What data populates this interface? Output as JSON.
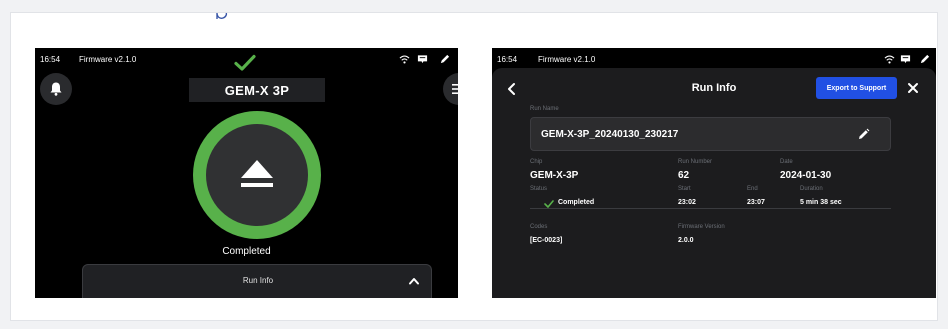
{
  "colors": {
    "success_green": "#58b14a",
    "export_blue": "#2150e4",
    "screen_bg": "#000000",
    "panel_bg": "#1c1c1e"
  },
  "screen_main": {
    "status_bar": {
      "time": "16:54",
      "firmware": "Firmware v2.1.0",
      "icons": [
        "wifi-icon",
        "message-icon",
        "pen-nib-icon"
      ]
    },
    "bell_icon": "bell-icon",
    "menu_icon": "hamburger-menu-icon",
    "status_icon": "checkmark-icon",
    "device_name": "GEM-X 3P",
    "center_icon": "eject-icon",
    "state_label": "Completed",
    "drawer": {
      "label": "Run Info",
      "icon": "chevron-up-icon"
    }
  },
  "screen_runinfo": {
    "status_bar": {
      "time": "16:54",
      "firmware": "Firmware v2.1.0",
      "icons": [
        "wifi-icon",
        "message-icon",
        "pen-nib-icon"
      ]
    },
    "back_icon": "chevron-left-icon",
    "title": "Run Info",
    "export_label": "Export to Support",
    "close_icon": "close-icon",
    "run_name_label": "Run Name",
    "run_name": "GEM-X-3P_20240130_230217",
    "edit_icon": "pencil-icon",
    "chip_label": "Chip",
    "chip": "GEM-X-3P",
    "run_number_label": "Run Number",
    "run_number": "62",
    "date_label": "Date",
    "date": "2024-01-30",
    "status_label": "Status",
    "status": "Completed",
    "start_label": "Start",
    "start": "23:02",
    "end_label": "End",
    "end": "23:07",
    "duration_label": "Duration",
    "duration": "5 min 38 sec",
    "codes_label": "Codes",
    "codes": "[EC-0023]",
    "firmware_version_label": "Firmware Version",
    "firmware_version": "2.0.0"
  }
}
